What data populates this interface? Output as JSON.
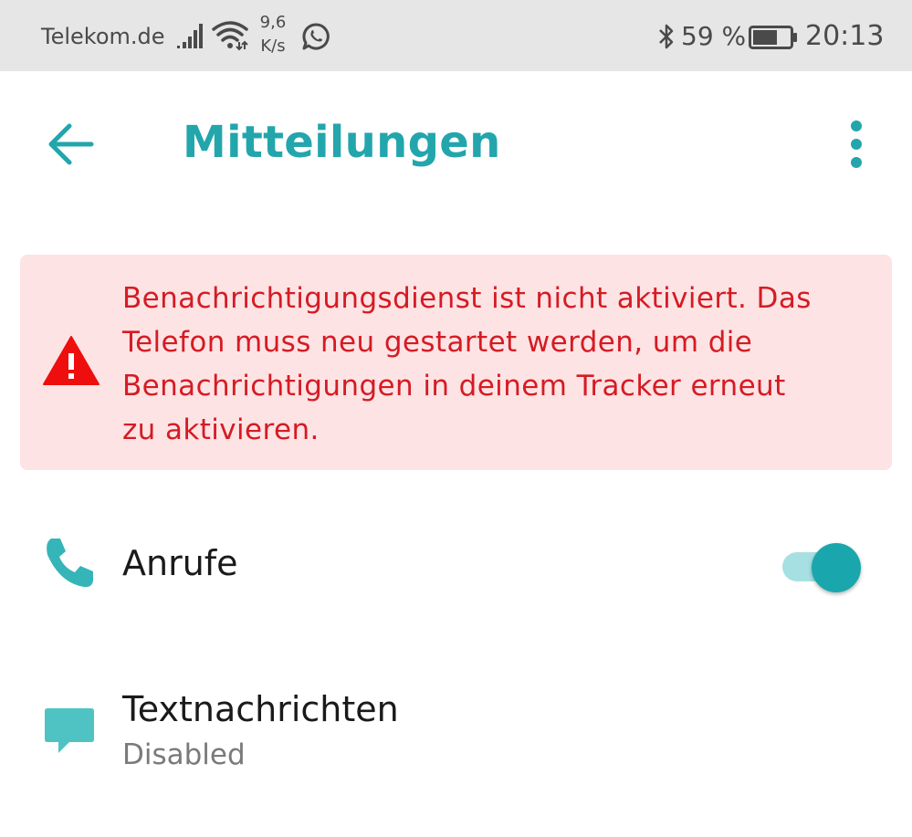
{
  "status_bar": {
    "carrier": "Telekom.de",
    "speed_value": "9,6",
    "speed_unit": "K/s",
    "battery_percent": "59 %",
    "time": "20:13",
    "icons": [
      "signal-icon",
      "wifi-icon",
      "whatsapp-icon",
      "bluetooth-icon",
      "battery-icon"
    ]
  },
  "app_bar": {
    "title": "Mitteilungen",
    "back_icon": "arrow-left-icon",
    "menu_icon": "more-vertical-icon"
  },
  "warning": {
    "icon": "warning-triangle-icon",
    "lines": [
      "Benachrichtigungsdienst ist nicht aktiviert. Das",
      "Telefon muss neu gestartet werden, um die",
      "Benachrichtigungen in deinem Tracker erneut",
      "zu aktivieren."
    ]
  },
  "rows": {
    "calls": {
      "icon": "phone-icon",
      "title": "Anrufe",
      "toggle_on": true
    },
    "sms": {
      "icon": "message-icon",
      "title": "Textnachrichten",
      "subtitle": "Disabled"
    }
  },
  "colors": {
    "accent": "#22a6ac",
    "warning_bg": "#fde3e4",
    "warning_text": "#d51b24",
    "statusbar_bg": "#e6e6e6",
    "toggle_track": "#a6e0e3",
    "toggle_thumb": "#19a7ad"
  }
}
